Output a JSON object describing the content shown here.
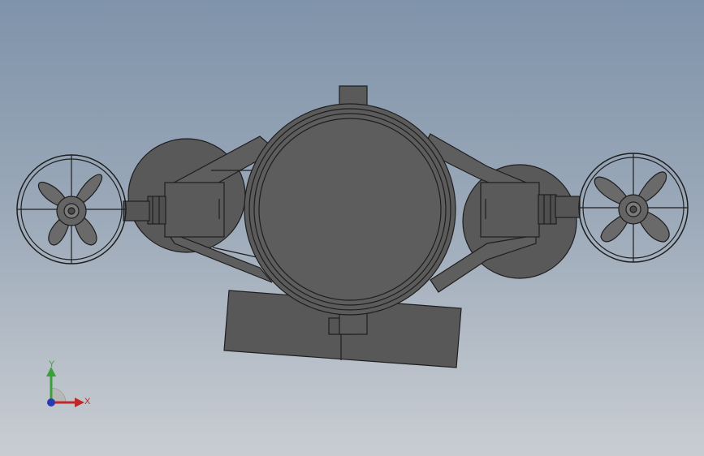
{
  "viewport": {
    "background_top": "#7f93aa",
    "background_bottom": "#c9cdd2"
  },
  "model": {
    "body_color": "#5c5c5c",
    "edge_color": "#1e1e1e",
    "propeller_color": "#6a6a6a"
  },
  "triad": {
    "y_label": "Y",
    "x_label": "X",
    "y_color": "#3aa03a",
    "x_color": "#c0292b",
    "z_color": "#2a3bb0"
  }
}
